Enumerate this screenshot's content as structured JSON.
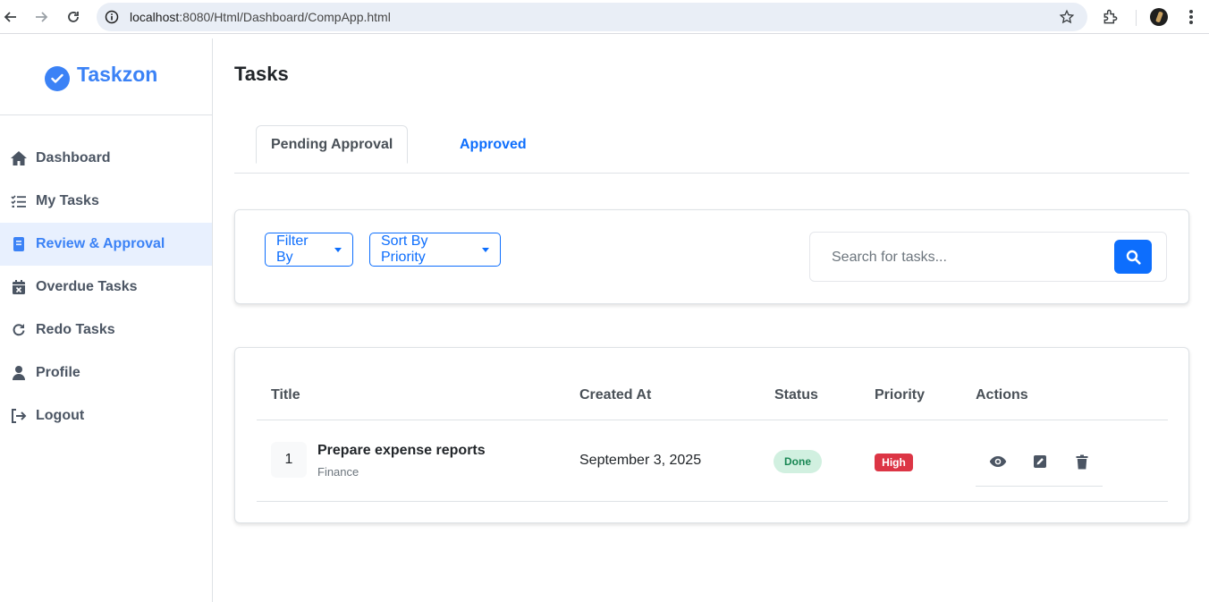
{
  "browser": {
    "url_host": "localhost",
    "url_rest": ":8080/Html/Dashboard/CompApp.html"
  },
  "brand": {
    "name": "Taskzon",
    "color": "#3b82f6"
  },
  "sidebar": {
    "items": [
      {
        "label": "Dashboard",
        "icon": "home-icon",
        "active": false
      },
      {
        "label": "My Tasks",
        "icon": "checklist-icon",
        "active": false
      },
      {
        "label": "Review & Approval",
        "icon": "book-icon",
        "active": true
      },
      {
        "label": "Overdue Tasks",
        "icon": "calendar-x-icon",
        "active": false
      },
      {
        "label": "Redo Tasks",
        "icon": "redo-icon",
        "active": false
      },
      {
        "label": "Profile",
        "icon": "user-icon",
        "active": false
      },
      {
        "label": "Logout",
        "icon": "logout-icon",
        "active": false
      }
    ]
  },
  "page": {
    "title": "Tasks"
  },
  "tabs": [
    {
      "label": "Pending Approval",
      "active": true
    },
    {
      "label": "Approved",
      "active": false
    }
  ],
  "filters": {
    "filter_label": "Filter By",
    "sort_label": "Sort By Priority",
    "search_placeholder": "Search for tasks..."
  },
  "table": {
    "headers": {
      "title": "Title",
      "created": "Created At",
      "status": "Status",
      "priority": "Priority",
      "actions": "Actions"
    },
    "rows": [
      {
        "num": "1",
        "title": "Prepare expense reports",
        "category": "Finance",
        "created": "September 3, 2025",
        "status": "Done",
        "priority": "High"
      }
    ]
  },
  "colors": {
    "primary": "#0d6efd",
    "status_done_bg": "#d1f0e0",
    "status_done_text": "#198754",
    "priority_high": "#dc3545"
  }
}
